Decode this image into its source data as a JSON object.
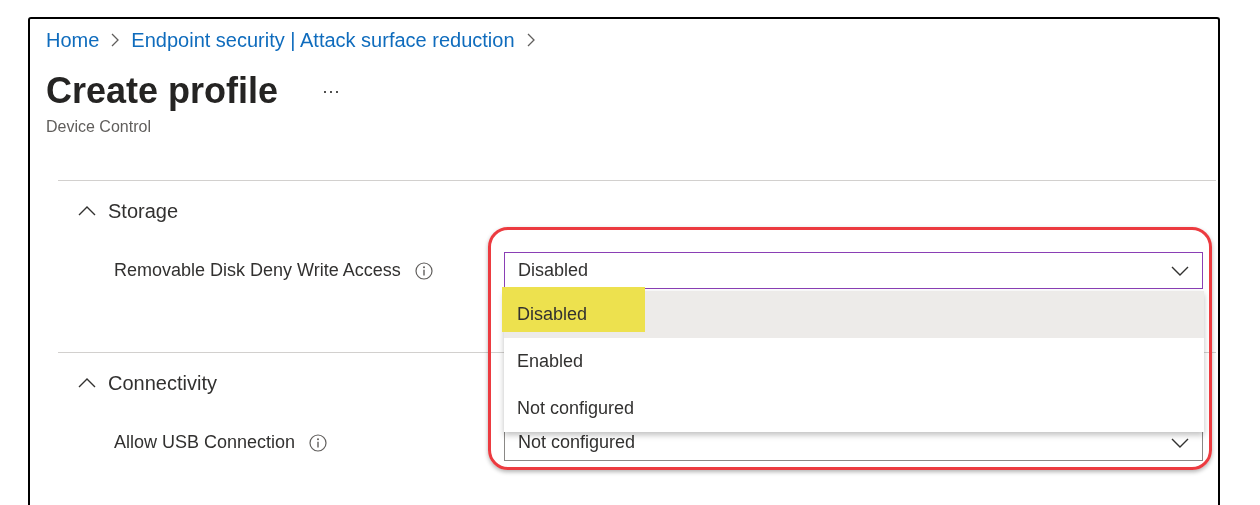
{
  "breadcrumbs": [
    {
      "label": "Home"
    },
    {
      "label": "Endpoint security | Attack surface reduction"
    }
  ],
  "page": {
    "title": "Create profile",
    "more": "···",
    "subtitle": "Device Control"
  },
  "sections": [
    {
      "title": "Storage",
      "expanded": true,
      "settings": [
        {
          "label": "Removable Disk Deny Write Access",
          "value": "Disabled",
          "open": true,
          "options": [
            {
              "label": "Disabled",
              "selected": true,
              "highlighted": true
            },
            {
              "label": "Enabled",
              "selected": false,
              "highlighted": false
            },
            {
              "label": "Not configured",
              "selected": false,
              "highlighted": false
            }
          ]
        }
      ]
    },
    {
      "title": "Connectivity",
      "expanded": true,
      "settings": [
        {
          "label": "Allow USB Connection",
          "value": "Not configured",
          "open": false
        }
      ]
    }
  ]
}
